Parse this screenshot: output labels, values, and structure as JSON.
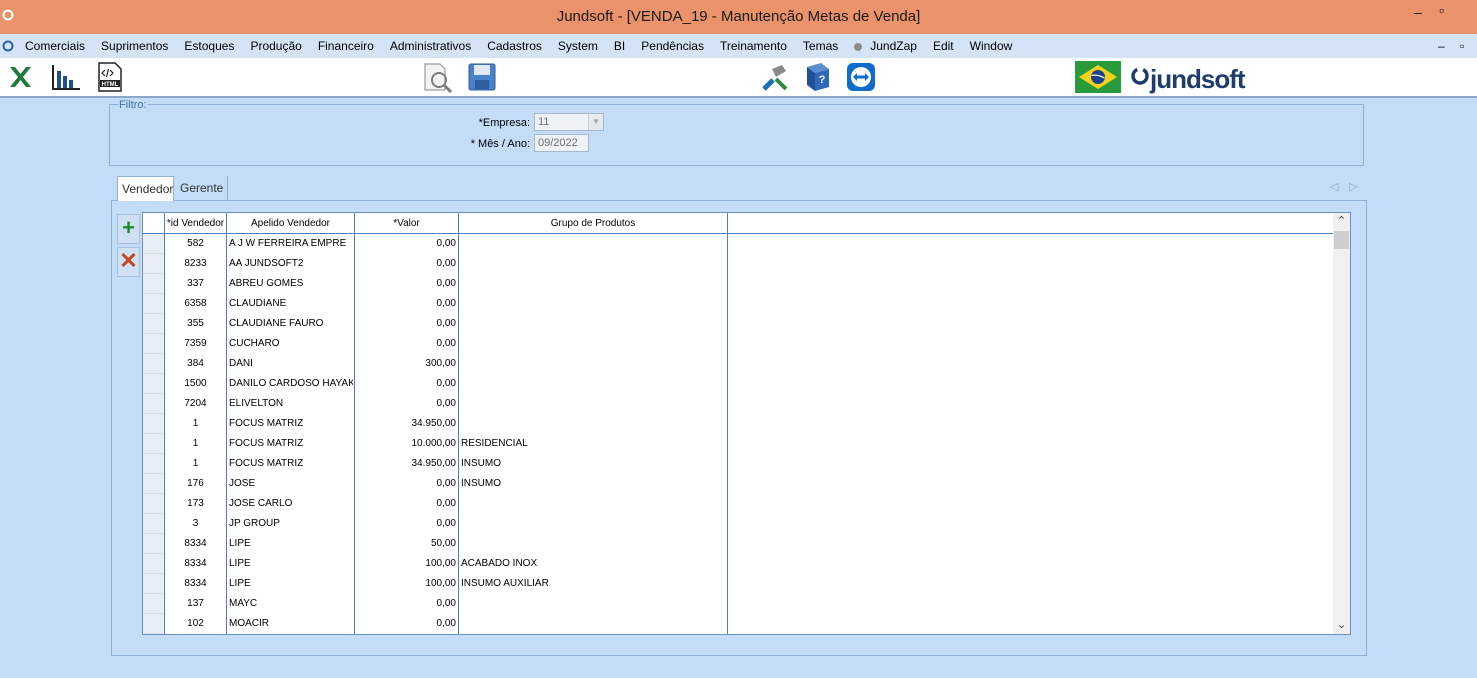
{
  "window": {
    "title": "Jundsoft - [VENDA_19 - Manutenção Metas de Venda]",
    "min": "–",
    "restore": "▫"
  },
  "menu": {
    "items": [
      "Comerciais",
      "Suprimentos",
      "Estoques",
      "Produção",
      "Financeiro",
      "Administrativos",
      "Cadastros",
      "System",
      "BI",
      "Pendências",
      "Treinamento",
      "Temas",
      "JundZap",
      "Edit",
      "Window"
    ],
    "min": "–",
    "restore": "▫"
  },
  "toolbar": {
    "logo_text": "jundsoft",
    "icons": [
      "excel-icon",
      "chart-icon",
      "html-icon",
      "print-preview-icon",
      "save-icon",
      "tools-icon",
      "help-book-icon",
      "teamviewer-icon",
      "brazil-flag-icon"
    ]
  },
  "filter": {
    "legend": "Filtro:",
    "empresa_label": "*Empresa:",
    "empresa_value": "11",
    "mes_label": "* Mês / Ano:",
    "mes_value": "09/2022"
  },
  "tabs": [
    {
      "label": "Vendedor",
      "active": true
    },
    {
      "label": "Gerente",
      "active": false
    }
  ],
  "grid": {
    "headers": [
      "*id Vendedor",
      "Apelido Vendedor",
      "*Valor",
      "Grupo de Produtos"
    ],
    "rows": [
      [
        "582",
        "A J W FERREIRA EMPRE",
        "0,00",
        ""
      ],
      [
        "8233",
        "AA JUNDSOFT2",
        "0,00",
        ""
      ],
      [
        "337",
        "ABREU GOMES",
        "0,00",
        ""
      ],
      [
        "6358",
        "CLAUDIANE",
        "0,00",
        ""
      ],
      [
        "355",
        "CLAUDIANE FAURO",
        "0,00",
        ""
      ],
      [
        "7359",
        "CUCHARO",
        "0,00",
        ""
      ],
      [
        "384",
        "DANI",
        "300,00",
        ""
      ],
      [
        "1500",
        "DANILO CARDOSO HAYAK",
        "0,00",
        ""
      ],
      [
        "7204",
        "ELIVELTON",
        "0,00",
        ""
      ],
      [
        "1",
        "FOCUS MATRIZ",
        "34.950,00",
        ""
      ],
      [
        "1",
        "FOCUS MATRIZ",
        "10.000,00",
        "RESIDENCIAL"
      ],
      [
        "1",
        "FOCUS MATRIZ",
        "34.950,00",
        "INSUMO"
      ],
      [
        "176",
        "JOSE",
        "0,00",
        "INSUMO"
      ],
      [
        "173",
        "JOSE CARLO",
        "0,00",
        ""
      ],
      [
        "3",
        "JP GROUP",
        "0,00",
        ""
      ],
      [
        "8334",
        "LIPE",
        "50,00",
        ""
      ],
      [
        "8334",
        "LIPE",
        "100,00",
        "ACABADO INOX"
      ],
      [
        "8334",
        "LIPE",
        "100,00",
        "INSUMO AUXILIAR"
      ],
      [
        "137",
        "MAYC",
        "0,00",
        ""
      ],
      [
        "102",
        "MOACIR",
        "0,00",
        ""
      ]
    ]
  },
  "colors": {
    "titlebar": "#ea936a",
    "background": "#c3dcf8",
    "grid_lines": "#4d7fc2"
  }
}
